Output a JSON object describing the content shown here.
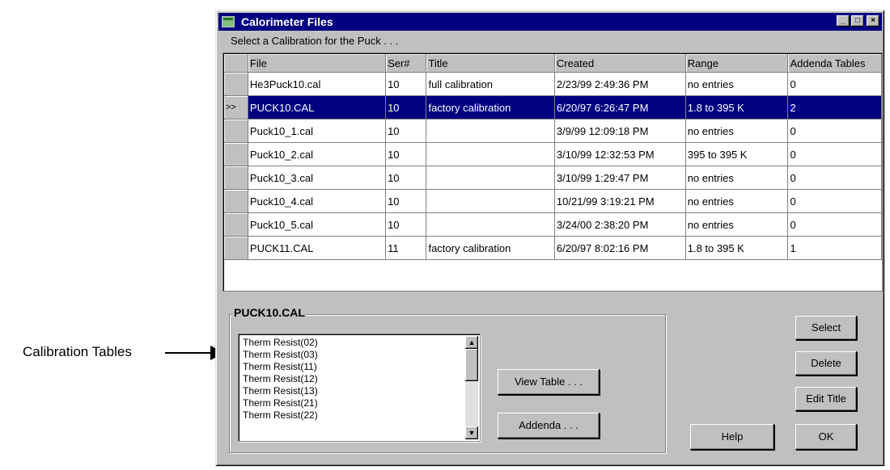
{
  "annotation": {
    "label": "Calibration Tables"
  },
  "window": {
    "title": "Calorimeter Files",
    "minimize": "_",
    "maximize": "□",
    "close": "×"
  },
  "prompt": "Select a Calibration for the Puck . . .",
  "grid": {
    "columns": [
      "File",
      "Ser#",
      "Title",
      "Created",
      "Range",
      "Addenda Tables"
    ],
    "rows": [
      {
        "marker": "",
        "file": "He3Puck10.cal",
        "ser": "10",
        "title": "full calibration",
        "created": "2/23/99 2:49:36 PM",
        "range": "no entries",
        "addenda": "0"
      },
      {
        "marker": ">>",
        "file": "PUCK10.CAL",
        "ser": "10",
        "title": "factory calibration",
        "created": "6/20/97 6:26:47 PM",
        "range": "1.8 to 395 K",
        "addenda": "2"
      },
      {
        "marker": "",
        "file": "Puck10_1.cal",
        "ser": "10",
        "title": "",
        "created": "3/9/99 12:09:18 PM",
        "range": "no entries",
        "addenda": "0"
      },
      {
        "marker": "",
        "file": "Puck10_2.cal",
        "ser": "10",
        "title": "",
        "created": "3/10/99 12:32:53 PM",
        "range": "395 to 395 K",
        "addenda": "0"
      },
      {
        "marker": "",
        "file": "Puck10_3.cal",
        "ser": "10",
        "title": "",
        "created": "3/10/99 1:29:47 PM",
        "range": "no entries",
        "addenda": "0"
      },
      {
        "marker": "",
        "file": "Puck10_4.cal",
        "ser": "10",
        "title": "",
        "created": "10/21/99 3:19:21 PM",
        "range": "no entries",
        "addenda": "0"
      },
      {
        "marker": "",
        "file": "Puck10_5.cal",
        "ser": "10",
        "title": "",
        "created": "3/24/00 2:38:20 PM",
        "range": "no entries",
        "addenda": "0"
      },
      {
        "marker": "",
        "file": "PUCK11.CAL",
        "ser": "11",
        "title": "factory calibration",
        "created": "6/20/97 8:02:16 PM",
        "range": "1.8 to 395 K",
        "addenda": "1"
      }
    ],
    "selected_index": 1
  },
  "details": {
    "group_title": "PUCK10.CAL",
    "tables": [
      "Therm Resist(02)",
      "Therm Resist(03)",
      "Therm Resist(11)",
      "Therm Resist(12)",
      "Therm Resist(13)",
      "Therm Resist(21)",
      "Therm Resist(22)"
    ],
    "view_table_label": "View Table . . .",
    "addenda_label": "Addenda . . ."
  },
  "buttons": {
    "select": "Select",
    "delete": "Delete",
    "edit_title": "Edit Title",
    "help": "Help",
    "ok": "OK"
  },
  "colors": {
    "titlebar": "#000080",
    "face": "#c0c0c0",
    "selection": "#000080"
  }
}
